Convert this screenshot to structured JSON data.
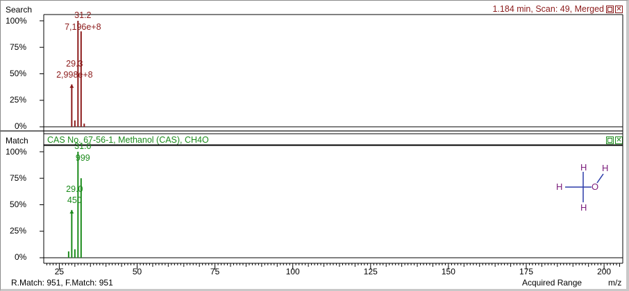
{
  "search_panel": {
    "label": "Search",
    "header": "1.184 min, Scan: 49, Merged",
    "color": "#8b1a1a",
    "yticks": [
      "100%",
      "75%",
      "50%",
      "25%",
      "0%"
    ]
  },
  "match_panel": {
    "label": "Match",
    "header": "CAS No. 67-56-1, Methanol (CAS), CH4O",
    "color": "#1a8a1a",
    "yticks": [
      "100%",
      "75%",
      "50%",
      "25%",
      "0%"
    ]
  },
  "footer": {
    "match_info": "R.Match: 951, F.Match: 951",
    "range_label": "Acquired Range",
    "axis_unit": "m/z"
  },
  "structure": {
    "atoms": [
      "H",
      "H",
      "H",
      "O",
      "H"
    ],
    "bond_color": "#2a3aa8",
    "atom_color": "#7a1a7a"
  },
  "chart_data": [
    {
      "type": "bar",
      "name": "search",
      "xlim": [
        20,
        206
      ],
      "ylim": [
        0,
        100
      ],
      "xticks": [
        25,
        50,
        75,
        100,
        125,
        150,
        175,
        200
      ],
      "x": [
        29.0,
        30.0,
        31.0,
        32.0,
        33.0
      ],
      "values": [
        40,
        6,
        100,
        90,
        3
      ],
      "annotations": [
        {
          "mz": "31.2",
          "intensity": "7,196e+8",
          "x": 31.0
        },
        {
          "mz": "29.3",
          "intensity": "2,998e+8",
          "x": 29.0
        }
      ]
    },
    {
      "type": "bar",
      "name": "match",
      "xlim": [
        20,
        206
      ],
      "ylim": [
        0,
        100
      ],
      "xticks": [
        25,
        50,
        75,
        100,
        125,
        150,
        175,
        200
      ],
      "x": [
        28.0,
        29.0,
        30.0,
        31.0,
        32.0
      ],
      "values": [
        6,
        45,
        8,
        100,
        75
      ],
      "annotations": [
        {
          "mz": "31.0",
          "intensity": "999",
          "x": 31.0
        },
        {
          "mz": "29.0",
          "intensity": "450",
          "x": 29.0
        }
      ]
    }
  ]
}
